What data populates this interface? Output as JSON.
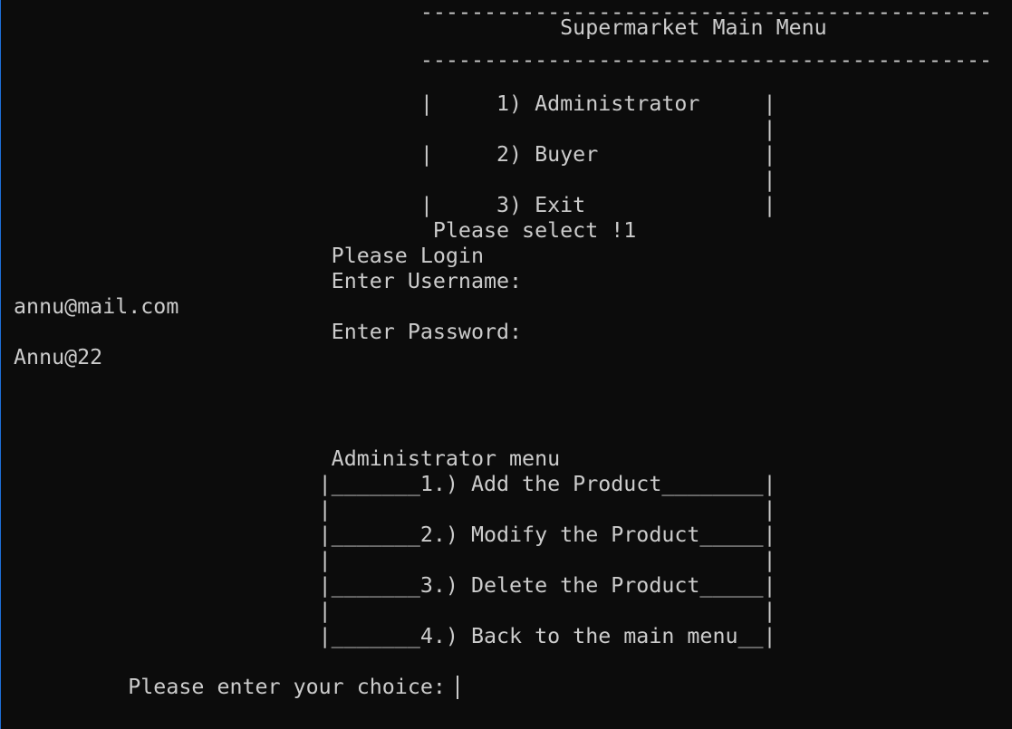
{
  "terminal": {
    "lines": [
      "                                 ---------------------------------------------",
      "                                            Supermarket Main Menu",
      "                                 ---------------------------------------------",
      "",
      "                                 |     1) Administrator     |",
      "                                                            |",
      "                                 |     2) Buyer             |",
      "                                                            |",
      "                                 |     3) Exit              |",
      "                                  Please select !1",
      "                          Please Login",
      "                          Enter Username:",
      " annu@mail.com",
      "                          Enter Password:",
      " Annu@22",
      "",
      "",
      "",
      "                          Administrator menu",
      "                         |_______1.) Add the Product________|",
      "                         |                                  |",
      "                         |_______2.) Modify the Product_____|",
      "                         |                                  |",
      "                         |_______3.) Delete the Product_____|",
      "                         |                                  |",
      "                         |_______4.) Back to the main menu__|",
      "",
      "          Please enter your choice: "
    ]
  }
}
